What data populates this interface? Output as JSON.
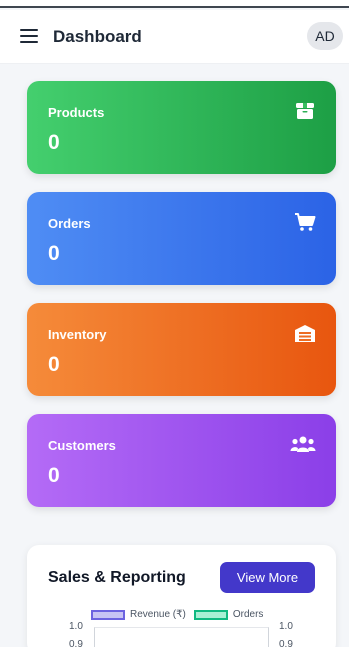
{
  "header": {
    "title": "Dashboard",
    "avatar_initials": "AD"
  },
  "cards": [
    {
      "label": "Products",
      "value": "0",
      "icon": "box-icon",
      "color_from": "#44cf6e",
      "color_to": "#1d9f45"
    },
    {
      "label": "Orders",
      "value": "0",
      "icon": "cart-icon",
      "color_from": "#4f8df4",
      "color_to": "#2b63e6"
    },
    {
      "label": "Inventory",
      "value": "0",
      "icon": "warehouse-icon",
      "color_from": "#f58b3a",
      "color_to": "#e8560f"
    },
    {
      "label": "Customers",
      "value": "0",
      "icon": "users-icon",
      "color_from": "#b46bf6",
      "color_to": "#8b3fe8"
    }
  ],
  "sales": {
    "title": "Sales & Reporting",
    "button_label": "View More",
    "legend": [
      {
        "label": "Revenue (₹)",
        "color": "#6c63e0"
      },
      {
        "label": "Orders",
        "color": "#10b981"
      }
    ],
    "y_ticks_left": [
      "1.0",
      "0.9"
    ],
    "y_ticks_right": [
      "1.0",
      "0.9"
    ]
  },
  "colors": {
    "accent": "#4338ca",
    "background": "#f4f6f9"
  }
}
